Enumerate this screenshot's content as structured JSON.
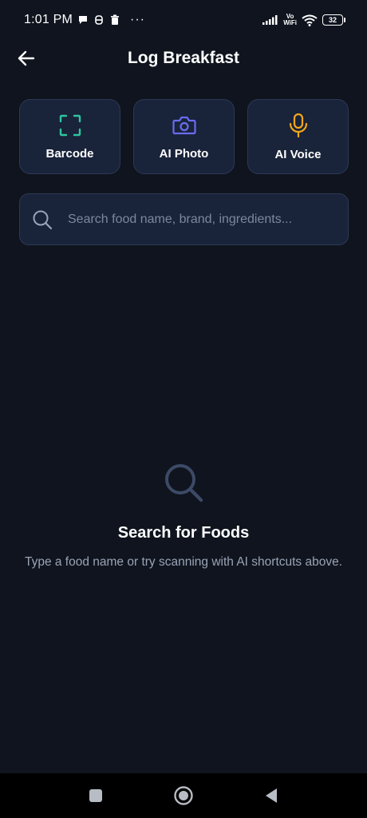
{
  "status_bar": {
    "time": "1:01 PM",
    "more": "···",
    "vo": "Vo",
    "wifi_text": "WiFi",
    "battery": "32"
  },
  "header": {
    "title": "Log Breakfast"
  },
  "shortcuts": [
    {
      "label": "Barcode",
      "icon": "barcode-scan-icon",
      "color": "#2ec4a0"
    },
    {
      "label": "AI Photo",
      "icon": "camera-icon",
      "color": "#6a6cf0"
    },
    {
      "label": "AI Voice",
      "icon": "microphone-icon",
      "color": "#f2a71b"
    }
  ],
  "search": {
    "placeholder": "Search food name, brand, ingredients...",
    "value": ""
  },
  "empty_state": {
    "title": "Search for Foods",
    "description": "Type a food name or try scanning with AI shortcuts above."
  },
  "colors": {
    "background": "#0f141e",
    "card": "#19233a",
    "card_border": "#2c3a54",
    "muted_text": "#9aa4b6",
    "empty_icon": "#3c4a66"
  }
}
